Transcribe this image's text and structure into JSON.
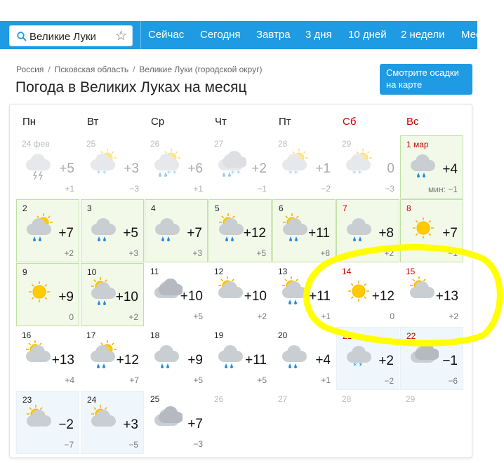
{
  "nav": {
    "search_value": "Великие Луки",
    "links": [
      "Сейчас",
      "Сегодня",
      "Завтра",
      "3 дня",
      "10 дней",
      "2 недели",
      "Мес"
    ]
  },
  "breadcrumbs": [
    "Россия",
    "Псковская область",
    "Великие Луки (городской округ)"
  ],
  "page_title": "Погода в Великих Луках на месяц",
  "map_button": "Смотрите осадки на карте",
  "weekdays": [
    "Пн",
    "Вт",
    "Ср",
    "Чт",
    "Пт",
    "Сб",
    "Вс"
  ],
  "min_label": "мин:",
  "colors": {
    "accent": "#1e9be2",
    "weekend": "#c00000",
    "highlight": "#ffff00"
  },
  "days": [
    {
      "date": "24 фев",
      "max": "+5",
      "min": "+1",
      "icon": "cloudy-thunderstorm-icon",
      "state": "past"
    },
    {
      "date": "25",
      "max": "+3",
      "min": "−3",
      "icon": "cloudy-sun-snow-icon",
      "state": "past"
    },
    {
      "date": "26",
      "max": "+6",
      "min": "+1",
      "icon": "cloudy-sun-sleet-icon",
      "state": "past"
    },
    {
      "date": "27",
      "max": "+2",
      "min": "−1",
      "icon": "overcast-sleet-icon",
      "state": "past"
    },
    {
      "date": "28",
      "max": "+1",
      "min": "−2",
      "icon": "cloudy-sun-snow-icon",
      "state": "past"
    },
    {
      "date": "29",
      "max": "0",
      "min": "−3",
      "icon": "cloudy-sun-snow-icon",
      "state": "past"
    },
    {
      "date": "1 мар",
      "max": "+4",
      "min": "−1",
      "icon": "cloudy-rain-icon",
      "state": "today"
    },
    {
      "date": "2",
      "max": "+7",
      "min": "+2",
      "icon": "cloudy-sun-rain-icon",
      "state": "future"
    },
    {
      "date": "3",
      "max": "+5",
      "min": "+3",
      "icon": "cloudy-rain-icon",
      "state": "future"
    },
    {
      "date": "4",
      "max": "+7",
      "min": "+3",
      "icon": "cloudy-rain-icon",
      "state": "future"
    },
    {
      "date": "5",
      "max": "+12",
      "min": "+5",
      "icon": "sun-cloud-rain-icon",
      "state": "future"
    },
    {
      "date": "6",
      "max": "+11",
      "min": "+8",
      "icon": "sun-cloud-rain-icon",
      "state": "future"
    },
    {
      "date": "7",
      "max": "+8",
      "min": "+2",
      "icon": "cloudy-rain-icon",
      "state": "future"
    },
    {
      "date": "8",
      "max": "+7",
      "min": "−1",
      "icon": "sun-icon",
      "state": "future"
    },
    {
      "date": "9",
      "max": "+9",
      "min": "0",
      "icon": "sun-icon",
      "state": "future"
    },
    {
      "date": "10",
      "max": "+10",
      "min": "+2",
      "icon": "sun-cloud-rain-icon",
      "state": "future"
    },
    {
      "date": "11",
      "max": "+10",
      "min": "+5",
      "icon": "overcast-icon",
      "state": "plain"
    },
    {
      "date": "12",
      "max": "+10",
      "min": "+2",
      "icon": "sun-cloud-icon",
      "state": "plain"
    },
    {
      "date": "13",
      "max": "+11",
      "min": "+1",
      "icon": "sun-cloud-rain-icon",
      "state": "plain"
    },
    {
      "date": "14",
      "max": "+12",
      "min": "0",
      "icon": "sun-icon",
      "state": "plain"
    },
    {
      "date": "15",
      "max": "+13",
      "min": "+2",
      "icon": "sun-cloud-icon",
      "state": "plain"
    },
    {
      "date": "16",
      "max": "+13",
      "min": "+4",
      "icon": "sun-cloud-icon",
      "state": "plain"
    },
    {
      "date": "17",
      "max": "+12",
      "min": "+7",
      "icon": "cloudy-sun-rain-icon",
      "state": "plain"
    },
    {
      "date": "18",
      "max": "+9",
      "min": "+5",
      "icon": "cloudy-rain-icon",
      "state": "plain"
    },
    {
      "date": "19",
      "max": "+11",
      "min": "+5",
      "icon": "cloudy-rain-icon",
      "state": "plain"
    },
    {
      "date": "20",
      "max": "+4",
      "min": "+1",
      "icon": "cloudy-rain-icon",
      "state": "plain"
    },
    {
      "date": "21",
      "max": "+2",
      "min": "−2",
      "icon": "cloudy-snow-icon",
      "state": "cold"
    },
    {
      "date": "22",
      "max": "−1",
      "min": "−6",
      "icon": "overcast-icon",
      "state": "cold"
    },
    {
      "date": "23",
      "max": "−2",
      "min": "−7",
      "icon": "sun-cloud-icon",
      "state": "cold"
    },
    {
      "date": "24",
      "max": "+3",
      "min": "−5",
      "icon": "sun-cloud-icon",
      "state": "cold"
    },
    {
      "date": "25",
      "max": "+7",
      "min": "−3",
      "icon": "overcast-icon",
      "state": "plain"
    },
    {
      "date": "26",
      "max": "",
      "min": "",
      "icon": "",
      "state": "empty"
    },
    {
      "date": "27",
      "max": "",
      "min": "",
      "icon": "",
      "state": "empty"
    },
    {
      "date": "28",
      "max": "",
      "min": "",
      "icon": "",
      "state": "empty"
    },
    {
      "date": "29",
      "max": "",
      "min": "",
      "icon": "",
      "state": "empty"
    }
  ]
}
